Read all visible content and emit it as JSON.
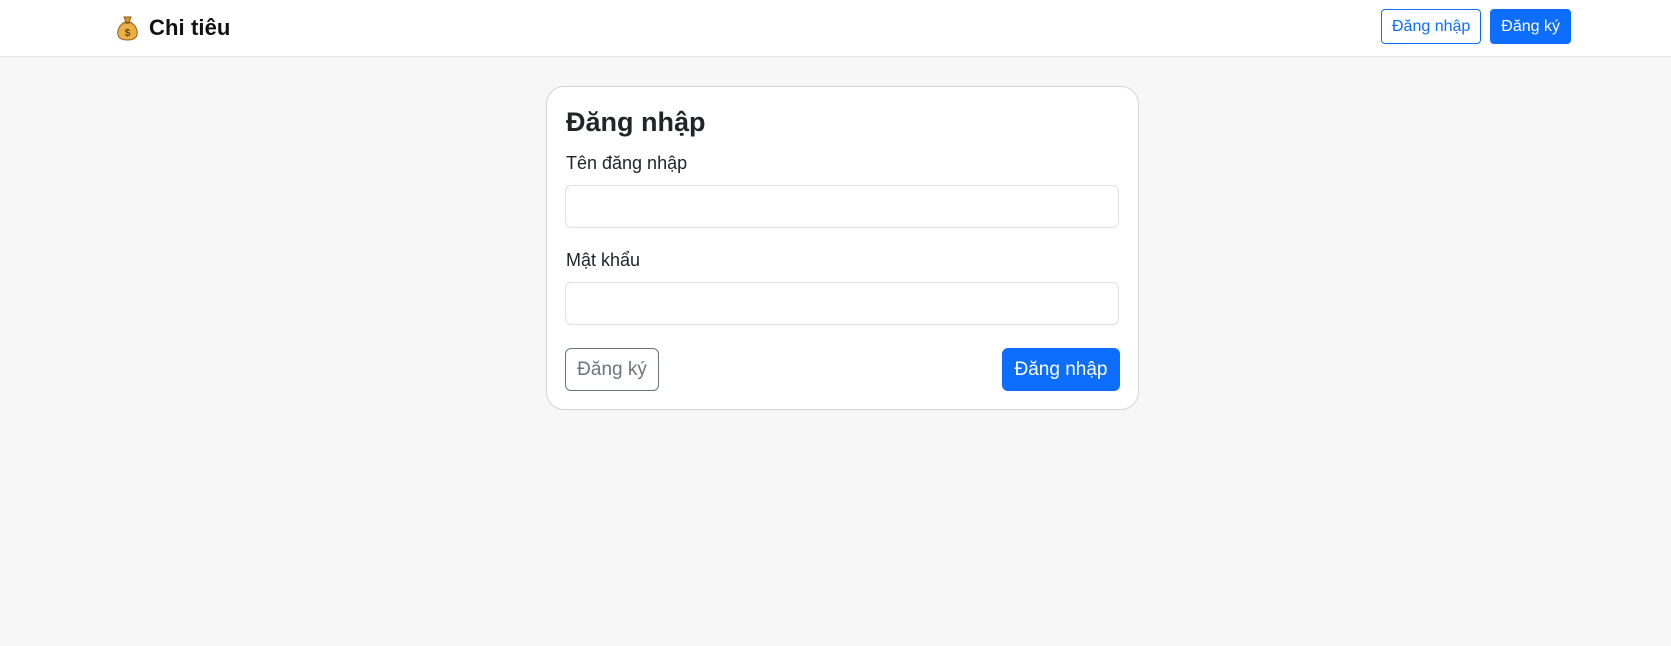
{
  "header": {
    "brand_icon": "money-bag-icon",
    "brand_name": "Chi tiêu",
    "login_label": "Đăng nhập",
    "register_label": "Đăng ký"
  },
  "login_form": {
    "title": "Đăng nhập",
    "username_label": "Tên đăng nhập",
    "username_value": "",
    "password_label": "Mật khẩu",
    "password_value": "",
    "register_label": "Đăng ký",
    "submit_label": "Đăng nhập"
  },
  "colors": {
    "primary": "#0d6efd",
    "secondary": "#6c757d",
    "page_background": "#f7f7f7"
  }
}
